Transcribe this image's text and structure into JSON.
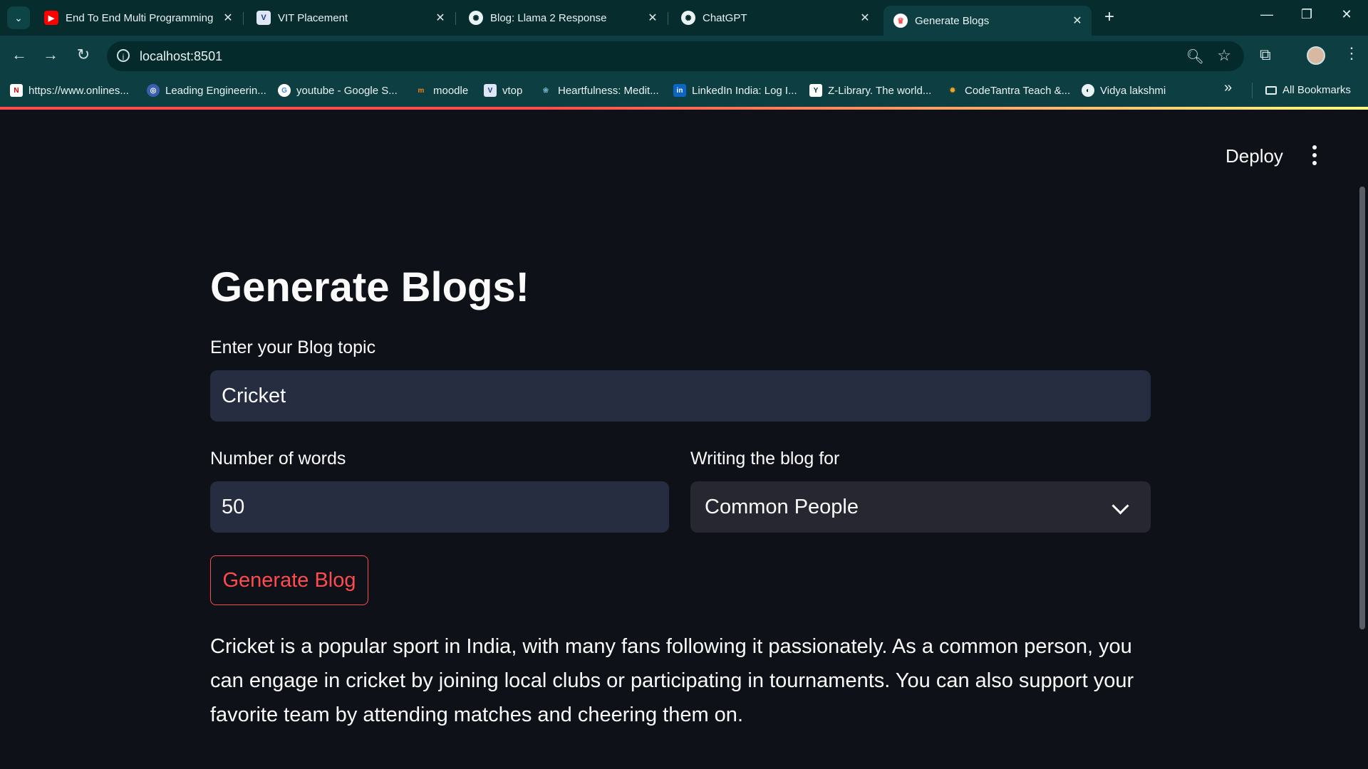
{
  "browser": {
    "tabs": [
      {
        "title": "End To End Multi Programming",
        "icon": "youtube-icon"
      },
      {
        "title": "VIT Placement",
        "icon": "vit-icon"
      },
      {
        "title": "Blog: Llama 2 Response",
        "icon": "openai-icon"
      },
      {
        "title": "ChatGPT",
        "icon": "openai-icon"
      },
      {
        "title": "Generate Blogs",
        "icon": "crown-icon",
        "active": true
      }
    ],
    "url": "localhost:8501",
    "bookmarks": [
      {
        "label": "https://www.onlines...",
        "icon": "nsdl-icon"
      },
      {
        "label": "Leading Engineerin...",
        "icon": "globe-icon"
      },
      {
        "label": "youtube - Google S...",
        "icon": "google-icon"
      },
      {
        "label": "moodle",
        "icon": "moodle-icon"
      },
      {
        "label": "vtop",
        "icon": "vtop-icon"
      },
      {
        "label": "Heartfulness: Medit...",
        "icon": "heartfulness-icon"
      },
      {
        "label": "LinkedIn India: Log I...",
        "icon": "linkedin-icon"
      },
      {
        "label": "Z-Library. The world...",
        "icon": "zlibrary-icon"
      },
      {
        "label": "CodeTantra Teach &...",
        "icon": "codetantra-icon"
      },
      {
        "label": "Vidya lakshmi",
        "icon": "vidyalakshmi-icon"
      }
    ],
    "all_bookmarks": "All Bookmarks"
  },
  "app": {
    "deploy": "Deploy",
    "title": "Generate Blogs!",
    "topic": {
      "label": "Enter your Blog topic",
      "value": "Cricket"
    },
    "words": {
      "label": "Number of words",
      "value": "50"
    },
    "audience": {
      "label": "Writing the blog for",
      "value": "Common People"
    },
    "button": "Generate Blog",
    "output": "Cricket is a popular sport in India, with many fans following it passionately. As a common person, you can engage in cricket by joining local clubs or participating in tournaments. You can also support your favorite team by attending matches and cheering them on."
  },
  "colors": {
    "background": "#0e1117",
    "input_bg": "#262d40",
    "accent": "#ff4b4b",
    "chrome": "#0d3f42"
  }
}
